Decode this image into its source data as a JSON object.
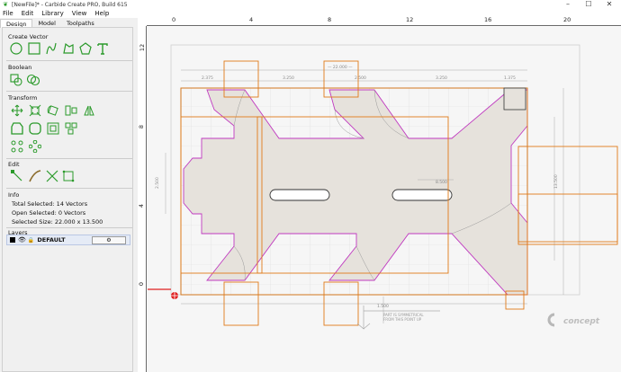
{
  "window": {
    "title": "[NewFile]* - Carbide Create PRO, Build 615",
    "app_icon": "carbide-leaf-icon",
    "controls": [
      "minimize-icon",
      "maximize-icon",
      "close-icon"
    ]
  },
  "menu": {
    "items": [
      "File",
      "Edit",
      "Library",
      "View",
      "Help"
    ]
  },
  "tabs": [
    "Design",
    "Model",
    "Toolpaths"
  ],
  "active_tab": "Design",
  "sections": {
    "create_vector": "Create Vector",
    "boolean": "Boolean",
    "transform": "Transform",
    "edit": "Edit",
    "info": "Info",
    "layers": "Layers"
  },
  "info": {
    "total_selected": "Total Selected:   14 Vectors",
    "open_selected": "Open Selected:   0 Vectors",
    "selected_size": "Selected Size:   22.000 x 13.500"
  },
  "layers": [
    {
      "name": "DEFAULT",
      "color": "#000000",
      "visible": true,
      "locked": true
    }
  ],
  "ruler": {
    "top_labels": [
      "0",
      "4",
      "8",
      "12",
      "16",
      "20"
    ],
    "left_labels": [
      "12",
      "8",
      "4",
      "0"
    ]
  },
  "drawing": {
    "annotation": [
      "PART IS SYMMETRICAL",
      "FROM THIS POINT UP"
    ],
    "logo": "concept"
  },
  "colors": {
    "selection_orange": "#e07a18",
    "vector_magenta": "#c03ac0",
    "part_fill": "#e6e2dc",
    "tool_green": "#2a9a2a",
    "origin_red": "#e02020"
  }
}
